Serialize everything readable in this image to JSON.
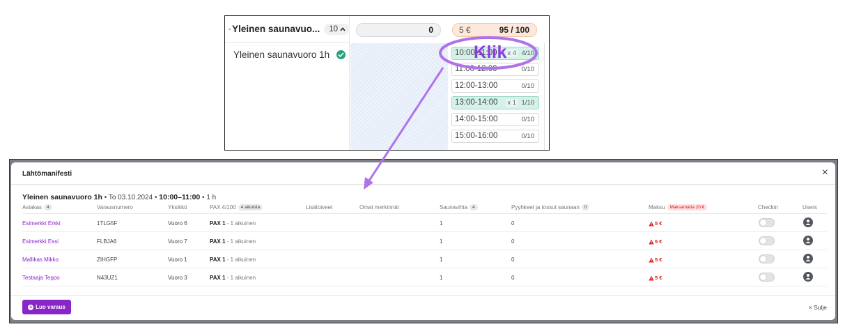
{
  "top_crop": {
    "group_title": "Yleinen saunavuo...",
    "group_count": "10",
    "sauna_name": "Yleinen saunavuoro 1h",
    "counter_value": "0",
    "price_value": "5 €",
    "price_capacity": "95 / 100",
    "slots": [
      {
        "time": "10:00-11:00",
        "mult": "x 4",
        "count": "4/10",
        "booked": true
      },
      {
        "time": "11:00-12:00",
        "mult": "",
        "count": "0/10",
        "booked": false
      },
      {
        "time": "12:00-13:00",
        "mult": "",
        "count": "0/10",
        "booked": false
      },
      {
        "time": "13:00-14:00",
        "mult": "x 1",
        "count": "1/10",
        "booked": true
      },
      {
        "time": "14:00-15:00",
        "mult": "",
        "count": "0/10",
        "booked": false
      },
      {
        "time": "15:00-16:00",
        "mult": "",
        "count": "0/10",
        "booked": false
      }
    ]
  },
  "annotation": {
    "label": "Klik",
    "accent_color": "#8d3ce0"
  },
  "modal": {
    "title": "Lähtömanifesti",
    "close_icon": "×",
    "info": {
      "service": "Yleinen saunavuoro 1h",
      "date_prefix": " • To 03.10.2024 • ",
      "time": "10:00–11:00",
      "duration": " • 1 h"
    },
    "columns": {
      "customer": "Asiakas",
      "customer_count": "4",
      "booking_number": "Varausnumero",
      "unit": "Yksikkö",
      "pax": "PAX 4/100",
      "pax_badge": "4 aikuista",
      "extras": "Lisätoiveet",
      "notes": "Omat merkinnät",
      "whisk": "Saunavihta",
      "whisk_count": "4",
      "towels": "Pyyhkeet ja tossut saunaan",
      "towels_count": "0",
      "payment": "Maksu",
      "payment_badge": "Maksamatta 20 €",
      "checkin": "Checkin",
      "users": "Users"
    },
    "rows": [
      {
        "customer": "Esimerkki Erkki",
        "booking_number": "1TLG5F",
        "unit": "Vuoro 6",
        "pax_count": "PAX 1",
        "pax_detail": " - 1 aikuinen",
        "whisk": "1",
        "towels": "0",
        "payment": "5 €"
      },
      {
        "customer": "Esimerkki Essi",
        "booking_number": "FLBJA6",
        "unit": "Vuoro 7",
        "pax_count": "PAX 1",
        "pax_detail": " - 1 aikuinen",
        "whisk": "1",
        "towels": "0",
        "payment": "5 €"
      },
      {
        "customer": "Mallikas Mikko",
        "booking_number": "ZIHGFP",
        "unit": "Vuoro 1",
        "pax_count": "PAX 1",
        "pax_detail": " - 1 aikuinen",
        "whisk": "1",
        "towels": "0",
        "payment": "5 €"
      },
      {
        "customer": "Testaaja Teppo",
        "booking_number": "N43UZ1",
        "unit": "Vuoro 3",
        "pax_count": "PAX 1",
        "pax_detail": " - 1 aikuinen",
        "whisk": "1",
        "towels": "0",
        "payment": "5 €"
      }
    ],
    "create_button": "Luo varaus",
    "close_button": "× Sulje"
  },
  "colors": {
    "brand_purple": "#8a26c8",
    "booked_slot": "#d6f1ea",
    "unpaid_red": "#e01b1b",
    "status_green": "#23a37e"
  },
  "icons": [
    "people-icon",
    "chevron-up-icon",
    "check-circle-icon",
    "warning-icon",
    "user-icon",
    "plus-icon",
    "close-icon"
  ]
}
